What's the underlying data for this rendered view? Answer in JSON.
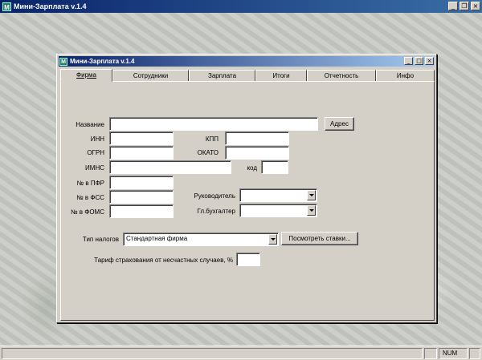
{
  "app": {
    "title": "Мини-Зарплата v.1.4",
    "icon": "M"
  },
  "window": {
    "title": "Мини-Зарплата v.1.4"
  },
  "tabs": [
    {
      "label": "Фирма"
    },
    {
      "label": "Сотрудники"
    },
    {
      "label": "Зарплата"
    },
    {
      "label": "Итоги"
    },
    {
      "label": "Отчетность"
    },
    {
      "label": "Инфо"
    }
  ],
  "form": {
    "name_label": "Название",
    "name_value": "",
    "address_button": "Адрес",
    "inn_label": "ИНН",
    "kpp_label": "КПП",
    "ogrn_label": "ОГРН",
    "okato_label": "ОКАТО",
    "imns_label": "ИМНС",
    "kod_label": "код",
    "pfr_label": "№ в ПФР",
    "fss_label": "№ в ФСС",
    "foms_label": "№ в ФОМС",
    "director_label": "Руководитель",
    "director_value": "",
    "accountant_label": "Гл.бухгалтер",
    "accountant_value": "",
    "tax_type_label": "Тип налогов",
    "tax_type_value": "Стандартная фирма",
    "view_rates_button": "Посмотреть ставки...",
    "accident_tariff_label": "Тариф страхования от несчастных случаев, %",
    "accident_tariff_value": ""
  },
  "statusbar": {
    "num": "NUM"
  }
}
